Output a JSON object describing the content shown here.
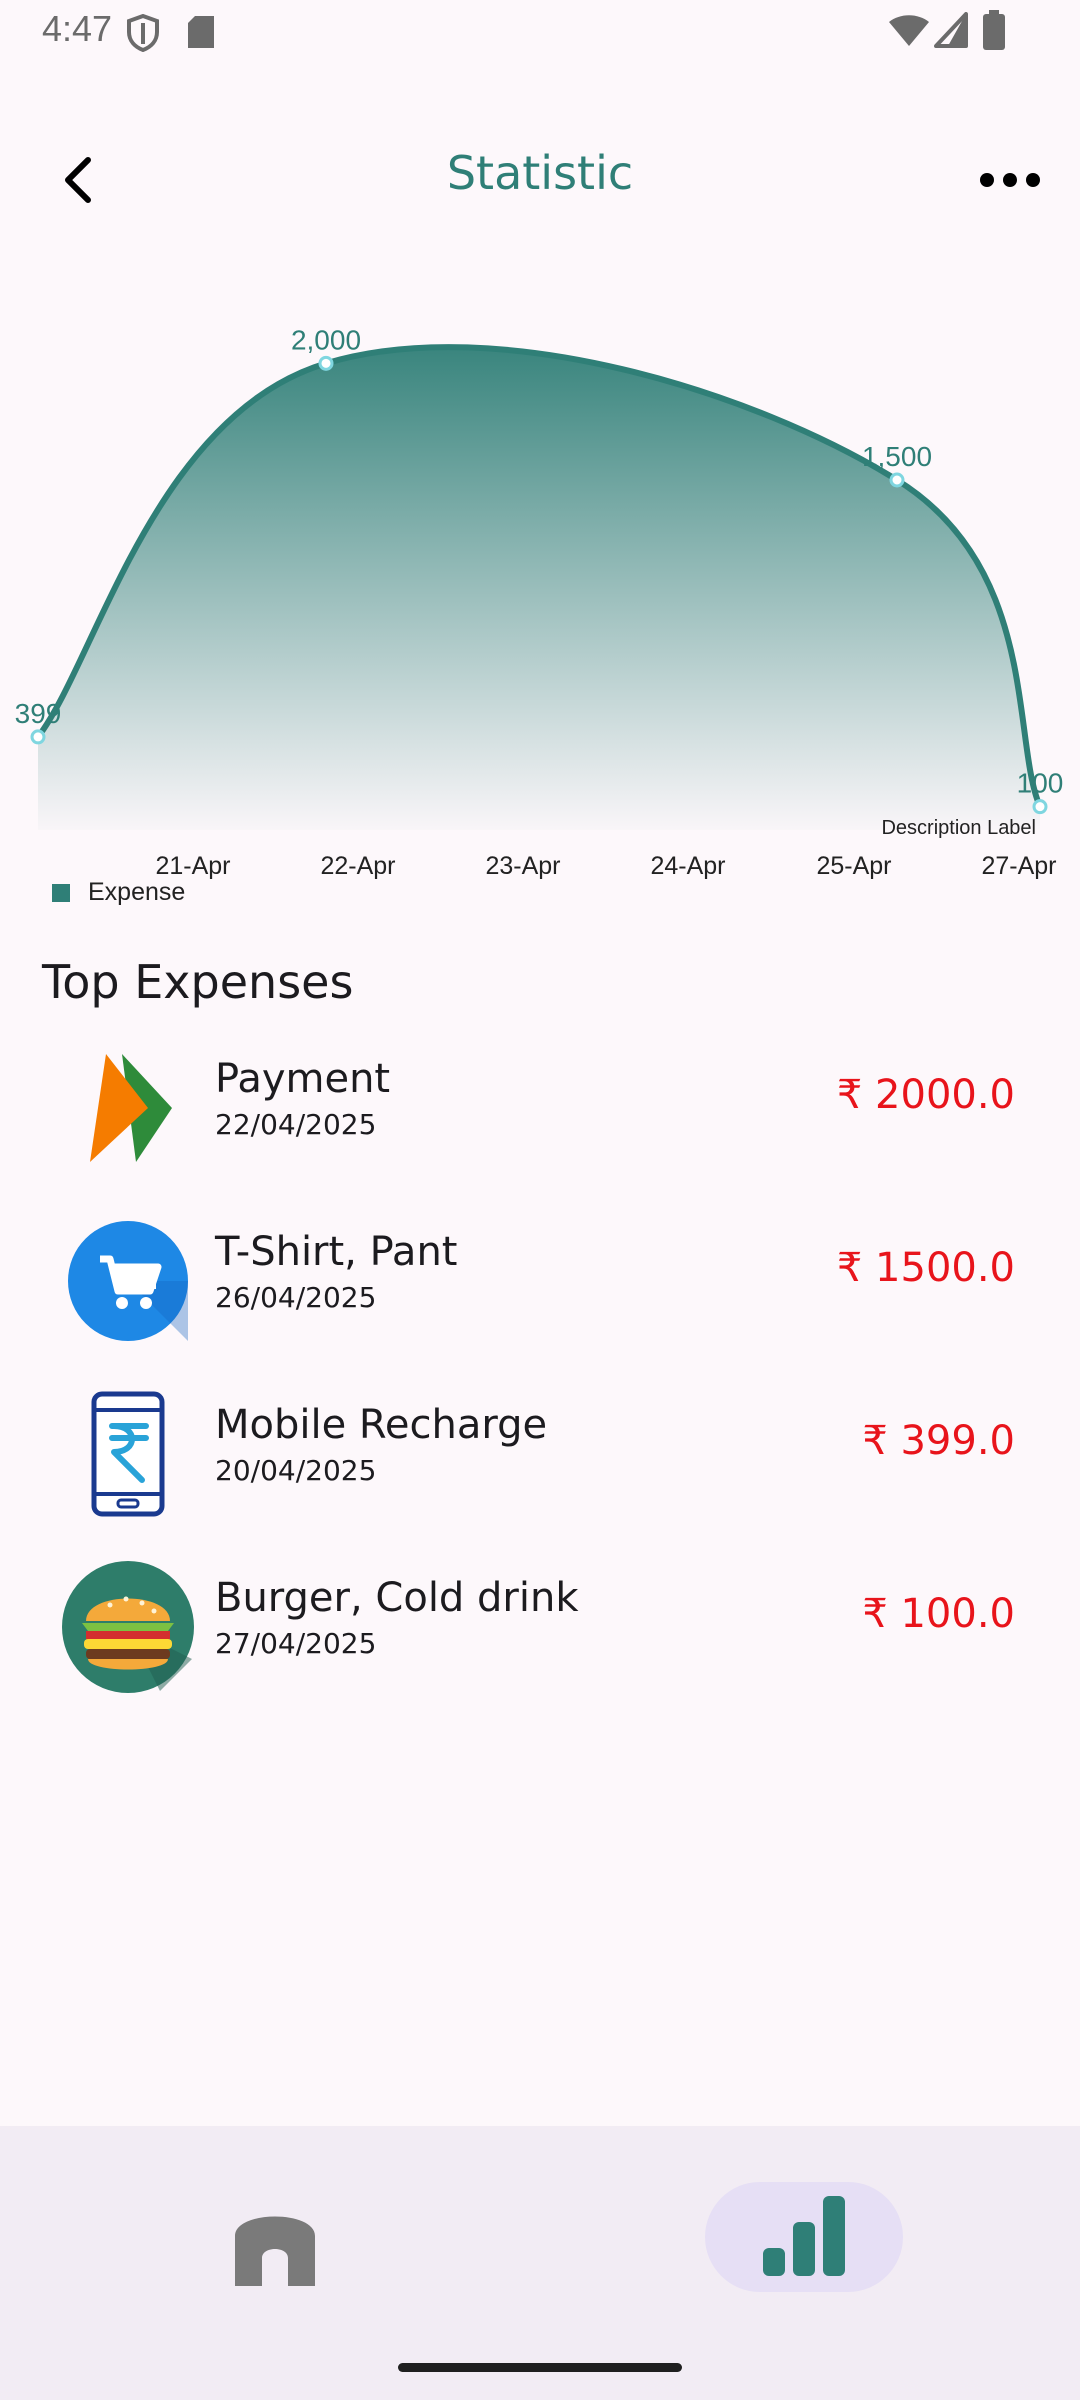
{
  "status_bar": {
    "time": "4:47"
  },
  "app_bar": {
    "title": "Statistic"
  },
  "chart_data": {
    "type": "area",
    "x": [
      "20-Apr",
      "22-Apr",
      "26-Apr",
      "27-Apr"
    ],
    "values": [
      399,
      2000,
      1500,
      100
    ],
    "point_labels": [
      "399",
      "2,000",
      "1,500",
      "100"
    ],
    "x_tick_labels": [
      "21-Apr",
      "22-Apr",
      "23-Apr",
      "24-Apr",
      "25-Apr",
      "27-Apr"
    ],
    "series": [
      {
        "name": "Expense",
        "values": [
          399,
          2000,
          1500,
          100
        ]
      }
    ],
    "description": "Description Label",
    "ylim": [
      0,
      2100
    ],
    "grid": false,
    "legend": "bottom-left",
    "color": "#2f7f77"
  },
  "legend": {
    "label": "Expense"
  },
  "section": {
    "title": "Top Expenses"
  },
  "expenses": [
    {
      "name": "Payment",
      "date": "22/04/2025",
      "amount": "₹ 2000.0",
      "icon": "upi-logo-icon"
    },
    {
      "name": "T-Shirt, Pant",
      "date": "26/04/2025",
      "amount": "₹ 1500.0",
      "icon": "shopping-cart-icon"
    },
    {
      "name": "Mobile Recharge",
      "date": "20/04/2025",
      "amount": "₹ 399.0",
      "icon": "mobile-recharge-icon"
    },
    {
      "name": "Burger, Cold drink",
      "date": "27/04/2025",
      "amount": "₹ 100.0",
      "icon": "burger-icon"
    }
  ],
  "colors": {
    "accent": "#2f7f77",
    "amount": "#e8141b",
    "nav_background": "#f2ecf4",
    "nav_active_pill": "#e6dff5"
  },
  "nav": {
    "items": [
      "home-icon",
      "bar-chart-icon"
    ],
    "active": "bar-chart-icon"
  }
}
